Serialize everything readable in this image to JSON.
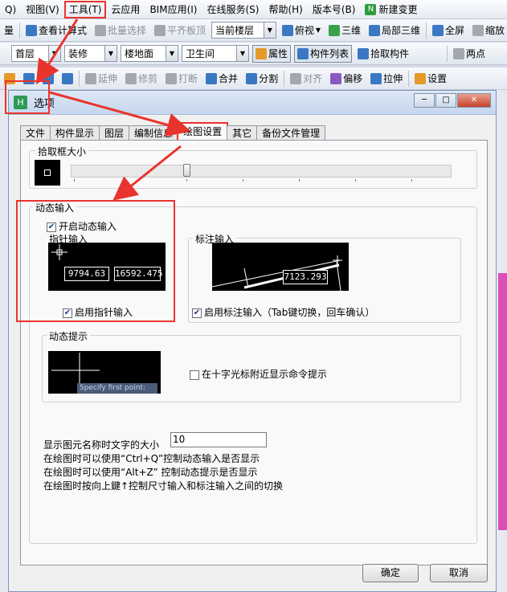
{
  "menubar": {
    "items": [
      "Q)",
      "视图(V)",
      "工具(T)",
      "云应用",
      "BIM应用(I)",
      "在线服务(S)",
      "帮助(H)",
      "版本号(B)",
      "新建变更"
    ]
  },
  "toolbar1": {
    "qty_label": "量",
    "view_calc_formula": "查看计算式",
    "batch_select": "批量选择",
    "align_slab_top": "平齐板顶",
    "floor_combo": "当前楼层",
    "top_view": "俯视",
    "three_d": "三维",
    "local_3d": "局部三维",
    "fullscreen": "全屏",
    "zoom": "缩放"
  },
  "toolbar2": {
    "floor": "首层",
    "decoration": "装修",
    "floor_surface": "楼地面",
    "bathroom": "卫生间",
    "properties": "属性",
    "component_list": "构件列表",
    "pick_component": "拾取构件",
    "two_points": "两点"
  },
  "toolbar3": {
    "extend": "延伸",
    "trim": "修剪",
    "break": "打断",
    "merge": "合并",
    "split": "分割",
    "align": "对齐",
    "offset": "偏移",
    "stretch": "拉伸",
    "settings": "设置"
  },
  "dialog": {
    "title": "选项",
    "tabs": [
      "文件",
      "构件显示",
      "图层",
      "编制信息",
      "绘图设置",
      "其它",
      "备份文件管理"
    ],
    "pick_box_group": "拾取框大小",
    "dynamic_input_group": "动态输入",
    "enable_dynamic_input": "开启动态输入",
    "pointer_input_label": "指针输入",
    "pointer_value_x": "9794.63",
    "pointer_value_y": "16592.475",
    "enable_pointer_input": "启用指针输入",
    "dim_input_label": "标注输入",
    "dim_value": "7123.293",
    "enable_dim_input": "启用标注输入（Tab键切换，回车确认）",
    "dynamic_prompt_group": "动态提示",
    "prompt_tooltip": "Specify first point:",
    "show_prompt_near_cursor": "在十字光标附近显示命令提示",
    "label_size_text": "显示图元名称时文字的大小",
    "label_size_value": "10",
    "hint1": "在绘图时可以使用“Ctrl+Q”控制动态输入是否显示",
    "hint2": "在绘图时可以使用“Alt+Z” 控制动态提示是否显示",
    "hint3": "在绘图时按向上鍵↑控制尺寸输入和标注输入之间的切换",
    "ok": "确定",
    "cancel": "取消"
  },
  "colors": {
    "highlight": "#e8342c",
    "dialog_bg": "#f0f0f0",
    "accent_pink": "#d94fb8"
  }
}
